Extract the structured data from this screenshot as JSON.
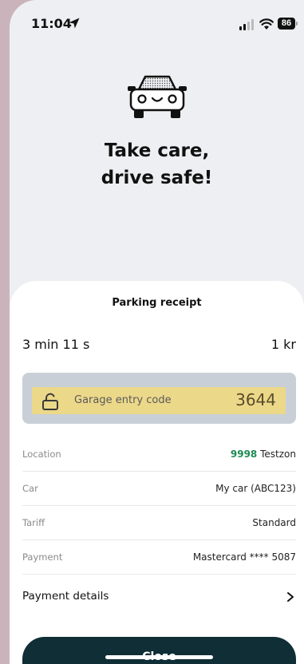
{
  "status_bar": {
    "time": "11:04",
    "battery": "86",
    "icons": [
      "location-arrow-icon",
      "signal-icon",
      "wifi-icon",
      "battery-icon"
    ]
  },
  "hero": {
    "icon": "car-icon",
    "headline_line1": "Take care,",
    "headline_line2": "drive safe!"
  },
  "receipt": {
    "title": "Parking receipt",
    "duration": "3 min 11 s",
    "amount": "1 kr",
    "entry_code": {
      "icon": "unlock-icon",
      "label": "Garage entry code",
      "value": "3644"
    },
    "rows": [
      {
        "label": "Location",
        "zone": "9998",
        "value": "Testzon"
      },
      {
        "label": "Car",
        "value": "My car (ABC123)"
      },
      {
        "label": "Tariff",
        "value": "Standard"
      },
      {
        "label": "Payment",
        "value": "Mastercard **** 5087"
      }
    ],
    "payment_details_label": "Payment details",
    "close_label": "Close"
  },
  "colors": {
    "background": "#eeeff2",
    "sheet": "#ffffff",
    "code_card": "#c8cfd7",
    "code_highlight": "#ecd889",
    "zone_green": "#1e8a53",
    "button": "#0f2e36"
  }
}
